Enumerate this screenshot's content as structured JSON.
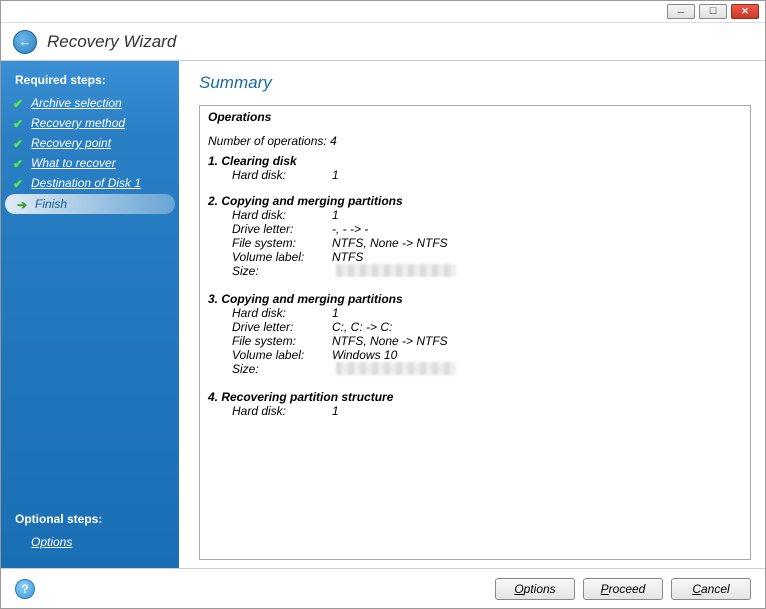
{
  "window": {
    "title": "Recovery Wizard"
  },
  "sidebar": {
    "required_header": "Required steps:",
    "optional_header": "Optional steps:",
    "steps": [
      {
        "label": "Archive selection",
        "done": true
      },
      {
        "label": "Recovery method",
        "done": true
      },
      {
        "label": "Recovery point",
        "done": true
      },
      {
        "label": "What to recover",
        "done": true
      },
      {
        "label": "Destination of Disk 1",
        "done": true
      },
      {
        "label": "Finish",
        "current": true
      }
    ],
    "optional": [
      {
        "label": "Options"
      }
    ]
  },
  "main": {
    "title": "Summary",
    "operations_header": "Operations",
    "count_line": "Number of operations: 4",
    "ops": [
      {
        "num": "1.",
        "title": "Clearing disk",
        "rows": [
          {
            "key": "Hard disk:",
            "val": "1"
          }
        ]
      },
      {
        "num": "2.",
        "title": "Copying and merging partitions",
        "rows": [
          {
            "key": "Hard disk:",
            "val": "1"
          },
          {
            "key": "Drive letter:",
            "val": "-, - -> -"
          },
          {
            "key": "File system:",
            "val": "NTFS, None -> NTFS"
          },
          {
            "key": "Volume label:",
            "val": "NTFS"
          },
          {
            "key": "Size:",
            "val": "",
            "blurred": true
          }
        ]
      },
      {
        "num": "3.",
        "title": "Copying and merging partitions",
        "rows": [
          {
            "key": "Hard disk:",
            "val": "1"
          },
          {
            "key": "Drive letter:",
            "val": "C:, C: -> C:"
          },
          {
            "key": "File system:",
            "val": "NTFS, None -> NTFS"
          },
          {
            "key": "Volume label:",
            "val": "Windows 10"
          },
          {
            "key": "Size:",
            "val": "",
            "blurred": true
          }
        ]
      },
      {
        "num": "4.",
        "title": "Recovering partition structure",
        "rows": [
          {
            "key": "Hard disk:",
            "val": "1"
          }
        ]
      }
    ]
  },
  "footer": {
    "options": "Options",
    "proceed": "Proceed",
    "cancel": "Cancel"
  }
}
